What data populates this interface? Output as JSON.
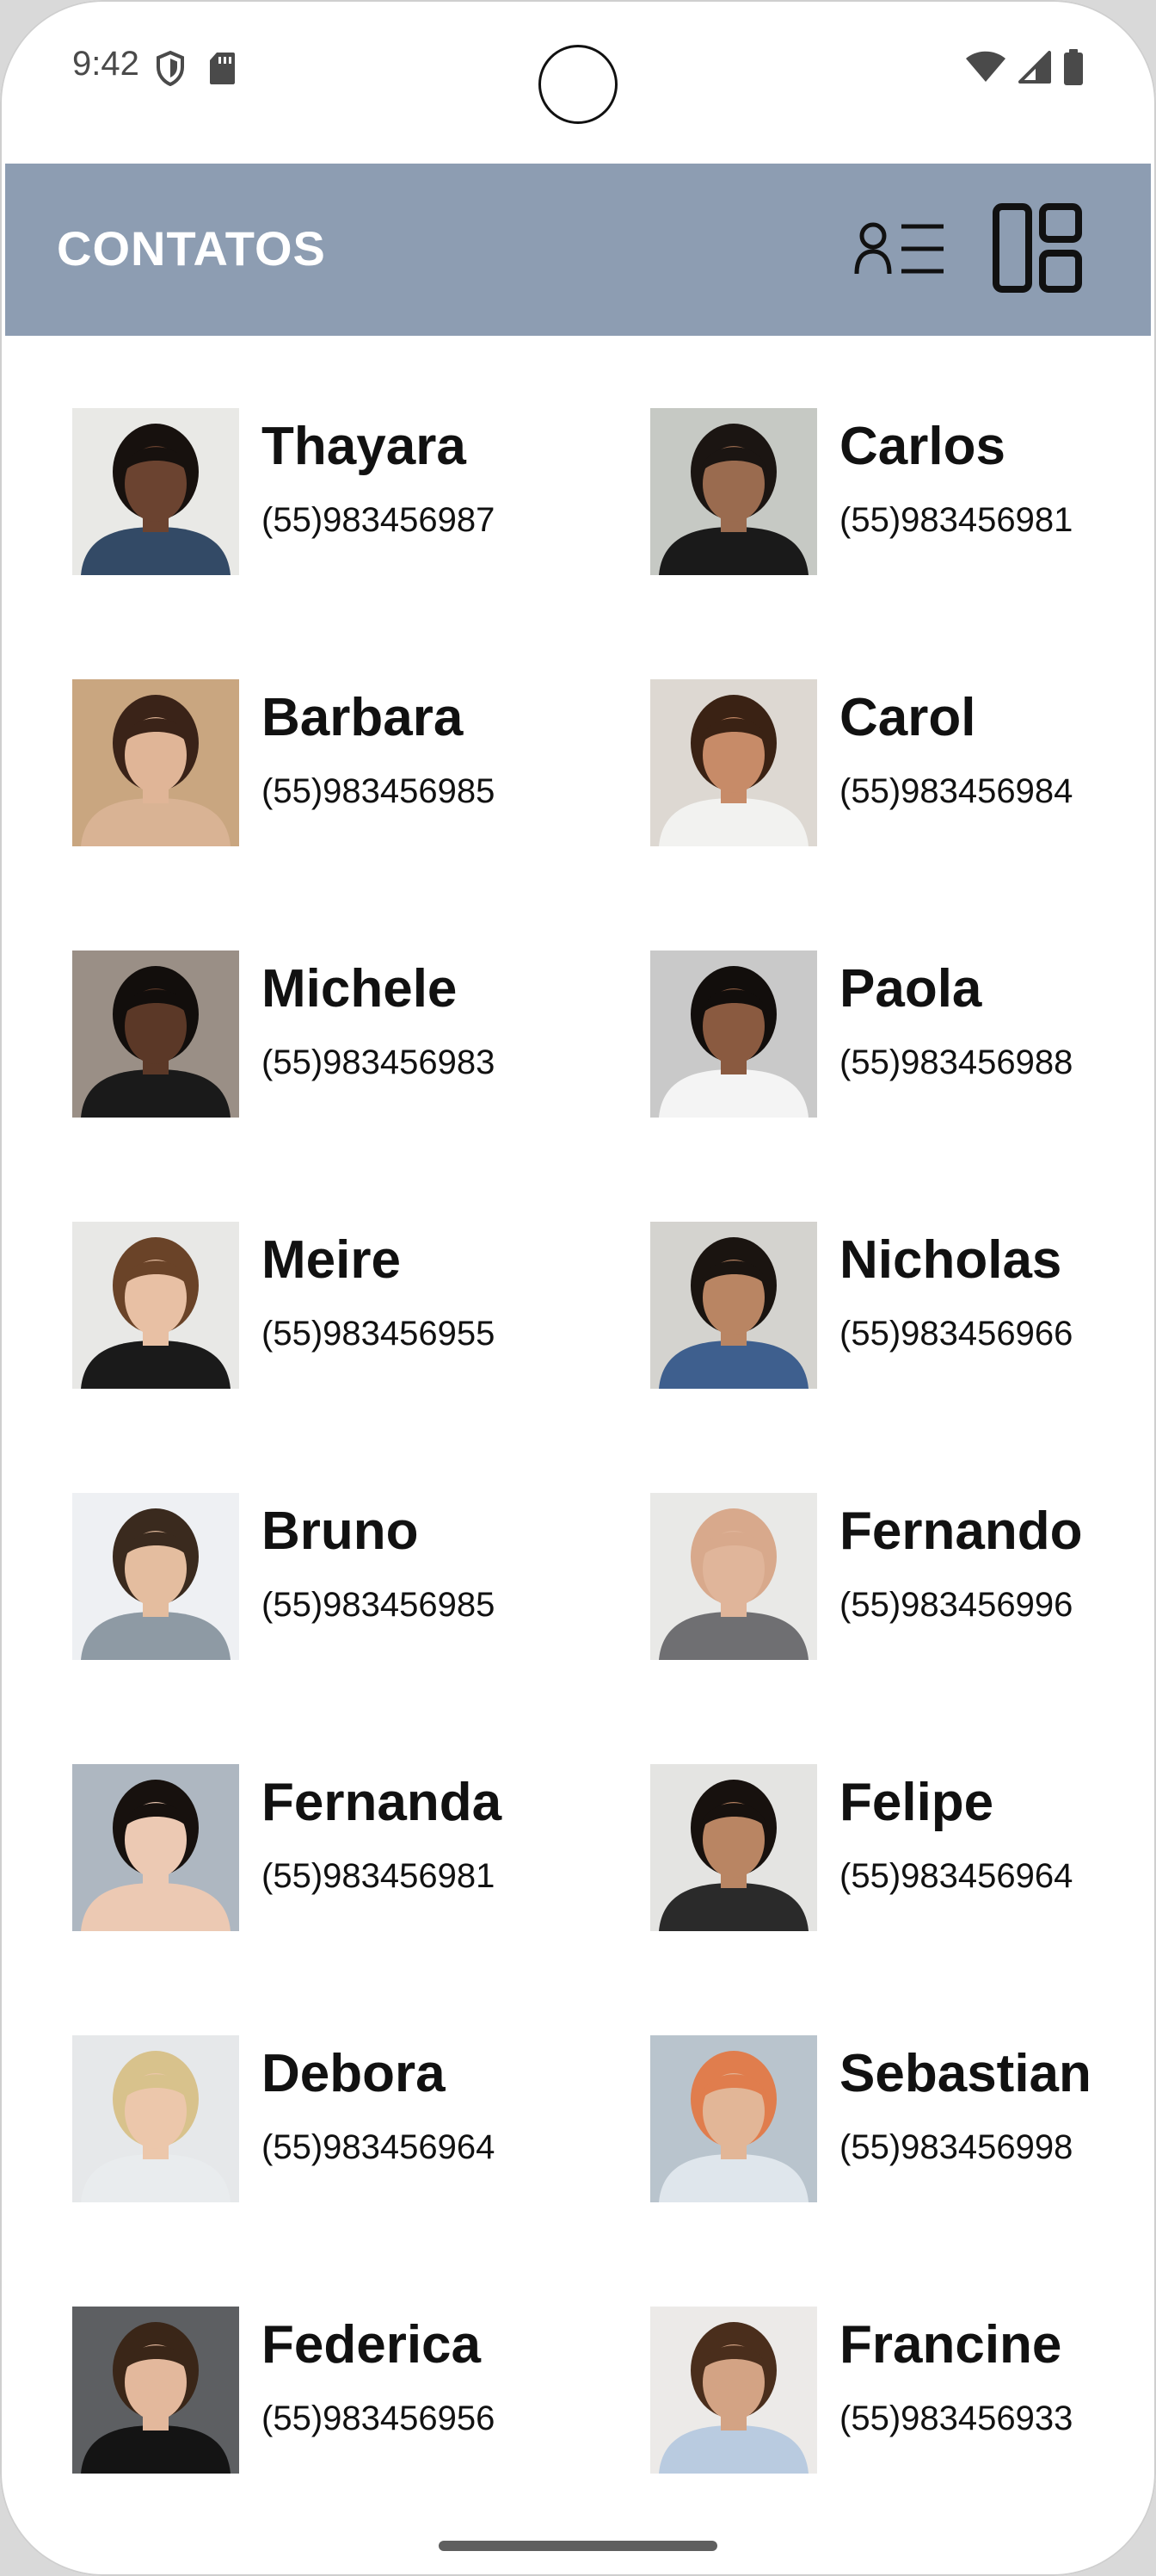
{
  "status_bar": {
    "time": "9:42",
    "left_icons": [
      "shield-icon",
      "sd-card-icon"
    ],
    "right_icons": [
      "wifi-icon",
      "signal-icon",
      "battery-icon"
    ]
  },
  "app_bar": {
    "title": "CONTATOS",
    "background": "#8d9db2",
    "actions": [
      {
        "name": "list-view-icon"
      },
      {
        "name": "grid-view-icon"
      }
    ]
  },
  "contacts": [
    {
      "name": "Thayara",
      "phone": "(55)983456987",
      "photo": {
        "bg": "#e9e9e6",
        "skin": "#6b4330",
        "hair": "#17110e",
        "shirt": "#334a66"
      }
    },
    {
      "name": "Carlos",
      "phone": "(55)983456981",
      "photo": {
        "bg": "#c6c9c4",
        "skin": "#9a6b4f",
        "hair": "#1b1512",
        "shirt": "#1a1a1a"
      }
    },
    {
      "name": "Barbara",
      "phone": "(55)983456985",
      "photo": {
        "bg": "#c9a680",
        "skin": "#e0b597",
        "hair": "#3a2318",
        "shirt": "#d9b394"
      }
    },
    {
      "name": "Carol",
      "phone": "(55)983456984",
      "photo": {
        "bg": "#ddd8d2",
        "skin": "#c78b68",
        "hair": "#3a2214",
        "shirt": "#f2f2f0"
      }
    },
    {
      "name": "Michele",
      "phone": "(55)983456983",
      "photo": {
        "bg": "#9a8f86",
        "skin": "#5b3827",
        "hair": "#120e0c",
        "shirt": "#1a1a1a"
      }
    },
    {
      "name": "Paola",
      "phone": "(55)983456988",
      "photo": {
        "bg": "#c9c9c9",
        "skin": "#8a5a40",
        "hair": "#120e0c",
        "shirt": "#f4f4f4"
      }
    },
    {
      "name": "Meire",
      "phone": "(55)983456955",
      "photo": {
        "bg": "#e8e8e6",
        "skin": "#e8c0a4",
        "hair": "#6a4328",
        "shirt": "#1a1a1a"
      }
    },
    {
      "name": "Nicholas",
      "phone": "(55)983456966",
      "photo": {
        "bg": "#d4d3cf",
        "skin": "#b98563",
        "hair": "#1a1410",
        "shirt": "#3e5f8e"
      }
    },
    {
      "name": "Bruno",
      "phone": "(55)983456985",
      "photo": {
        "bg": "#eef0f3",
        "skin": "#e4bd9f",
        "hair": "#3a2a1e",
        "shirt": "#8e9aa4"
      }
    },
    {
      "name": "Fernando",
      "phone": "(55)983456996",
      "photo": {
        "bg": "#e9e9e7",
        "skin": "#e0b59a",
        "hair": "#d8a98c",
        "shirt": "#6f6f72"
      }
    },
    {
      "name": "Fernanda",
      "phone": "(55)983456981",
      "photo": {
        "bg": "#aeb7c1",
        "skin": "#ecc9b3",
        "hair": "#17110e",
        "shirt": "#ecc9b3"
      }
    },
    {
      "name": "Felipe",
      "phone": "(55)983456964",
      "photo": {
        "bg": "#e4e4e2",
        "skin": "#b98563",
        "hair": "#17110e",
        "shirt": "#2a2a2a"
      }
    },
    {
      "name": "Debora",
      "phone": "(55)983456964",
      "photo": {
        "bg": "#e6e8ea",
        "skin": "#ecc7ab",
        "hair": "#d8c28c",
        "shirt": "#e9ecee"
      }
    },
    {
      "name": "Sebastian",
      "phone": "(55)983456998",
      "photo": {
        "bg": "#b9c4cd",
        "skin": "#e2b697",
        "hair": "#e07d4d",
        "shirt": "#dfe6ec"
      }
    },
    {
      "name": "Federica",
      "phone": "(55)983456956",
      "photo": {
        "bg": "#5d5f62",
        "skin": "#e3b89c",
        "hair": "#3a2618",
        "shirt": "#141414"
      }
    },
    {
      "name": "Francine",
      "phone": "(55)983456933",
      "photo": {
        "bg": "#eceae8",
        "skin": "#d3a384",
        "hair": "#4a2e1c",
        "shirt": "#b9cbe0"
      }
    }
  ]
}
